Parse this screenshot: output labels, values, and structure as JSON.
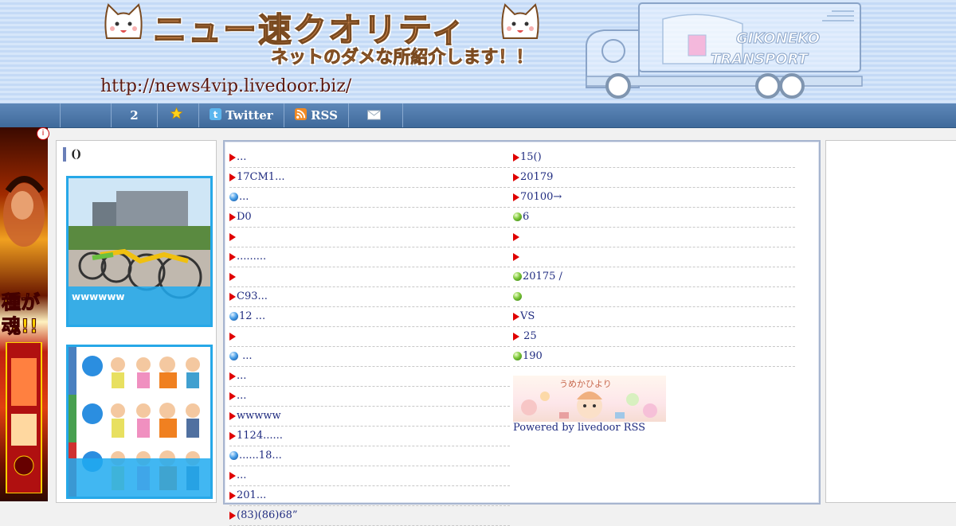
{
  "header": {
    "title": "ニュー速クオリティ",
    "subtitle": "ネットのダメな所紹介します！！",
    "url": "http://news4vip.livedoor.biz/",
    "truck_text_1": "GIKONEKO",
    "truck_text_2": "TRANSPORT"
  },
  "nav": {
    "items": [
      {
        "label": "",
        "icon": "blank"
      },
      {
        "label": "2",
        "icon": "none"
      },
      {
        "label": "",
        "icon": "star-icon"
      },
      {
        "label": "Twitter",
        "icon": "twitter-icon"
      },
      {
        "label": "RSS",
        "icon": "rss-icon"
      },
      {
        "label": "",
        "icon": "mail-icon"
      }
    ]
  },
  "left_ad": {
    "text": "種が魂!!",
    "info": "i"
  },
  "sidebar": {
    "heading": "()",
    "cards": [
      {
        "caption": "wwwwww",
        "image": "bicycles-photo"
      },
      {
        "caption": "",
        "image": "doraemon-characters-chart"
      }
    ]
  },
  "main": {
    "left_column": [
      {
        "text": "...",
        "marker": "triangle"
      },
      {
        "text": "17CM1...",
        "marker": "triangle"
      },
      {
        "text": "...",
        "marker": "blue-ball"
      },
      {
        "text": "D0",
        "marker": "triangle"
      },
      {
        "text": "",
        "marker": "triangle"
      },
      {
        "text": ".........",
        "marker": "triangle"
      },
      {
        "text": "",
        "marker": "triangle"
      },
      {
        "text": "C93...",
        "marker": "triangle"
      },
      {
        "text": "12 ...",
        "marker": "blue-ball"
      },
      {
        "text": "",
        "marker": "triangle"
      },
      {
        "text": " ...",
        "marker": "blue-ball"
      },
      {
        "text": "...",
        "marker": "triangle"
      },
      {
        "text": "...",
        "marker": "triangle"
      },
      {
        "text": "wwwww",
        "marker": "triangle"
      },
      {
        "text": "1124......",
        "marker": "triangle"
      },
      {
        "text": "......18...",
        "marker": "blue-ball"
      },
      {
        "text": "...",
        "marker": "triangle"
      },
      {
        "text": "201...",
        "marker": "triangle"
      },
      {
        "text": "(83)(86)68”",
        "marker": "triangle"
      }
    ],
    "right_column": [
      {
        "text": "15()",
        "marker": "triangle"
      },
      {
        "text": "20179",
        "marker": "triangle"
      },
      {
        "text": "70100→",
        "marker": "triangle"
      },
      {
        "text": "6",
        "marker": "green-ball"
      },
      {
        "text": "",
        "marker": "triangle"
      },
      {
        "text": "",
        "marker": "triangle"
      },
      {
        "text": "20175 /",
        "marker": "green-ball"
      },
      {
        "text": "",
        "marker": "green-ball"
      },
      {
        "text": "VS",
        "marker": "triangle"
      },
      {
        "text": " 25",
        "marker": "triangle"
      },
      {
        "text": "190",
        "marker": "green-ball"
      }
    ],
    "promo_title": "うめかひより",
    "powered_by": "Powered by livedoor RSS"
  }
}
